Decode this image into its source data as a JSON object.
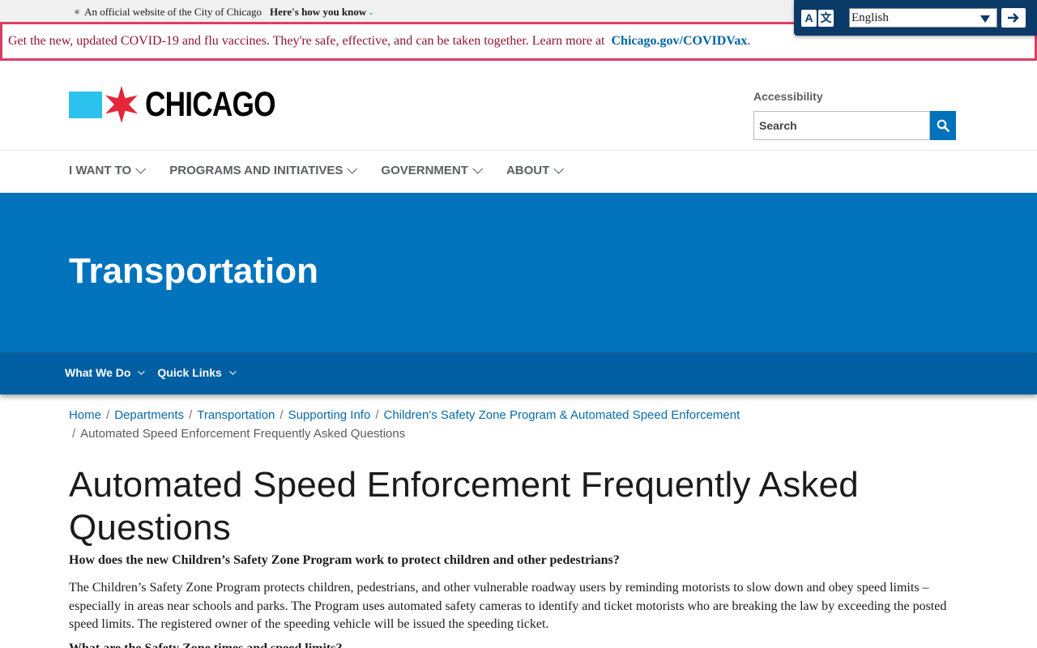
{
  "official_banner": {
    "text": "An official website of the City of Chicago",
    "link_label": "Here's how you know"
  },
  "translate": {
    "icon_a": "A",
    "icon_b": "文",
    "language": "English",
    "go_icon": "arrow-right-icon"
  },
  "alert": {
    "text": "Get the new, updated COVID-19 and flu vaccines. They're safe, effective, and can be taken together. Learn more at",
    "link": "Chicago.gov/COVIDVax",
    "trailing": "."
  },
  "header": {
    "logo_text": "CHICAGO",
    "accessibility": "Accessibility",
    "search_placeholder": "Search"
  },
  "main_nav": [
    {
      "label": "I WANT TO"
    },
    {
      "label": "PROGRAMS AND INITIATIVES"
    },
    {
      "label": "GOVERNMENT"
    },
    {
      "label": "ABOUT"
    }
  ],
  "hero": {
    "title": "Transportation"
  },
  "sub_nav": [
    {
      "label": "What We Do"
    },
    {
      "label": "Quick Links"
    }
  ],
  "breadcrumb": {
    "items": [
      "Home",
      "Departments",
      "Transportation",
      "Supporting Info",
      "Children's Safety Zone Program & Automated Speed Enforcement"
    ],
    "current": "Automated Speed Enforcement Frequently Asked Questions",
    "separator": "/"
  },
  "content": {
    "title": "Automated Speed Enforcement Frequently Asked Questions",
    "question1": "How does the new Children’s Safety Zone Program work to protect children and other pedestrians?",
    "answer1": "The Children’s Safety Zone Program protects children, pedestrians, and other vulnerable roadway users by reminding motorists to slow down and obey speed limits – especially in areas near schools and parks. The Program uses automated safety cameras to identify and ticket motorists who are breaking the law by exceeding the posted speed limits. The registered owner of the speeding vehicle will be issued the speeding ticket.",
    "question2": "What are the Safety Zone times and speed limits?"
  },
  "colors": {
    "brand_blue": "#0073bd",
    "subnav_blue": "#005ea2",
    "chicago_light_blue": "#2bc3ee",
    "chicago_red": "#e4253a",
    "alert_border": "#d83e65"
  }
}
